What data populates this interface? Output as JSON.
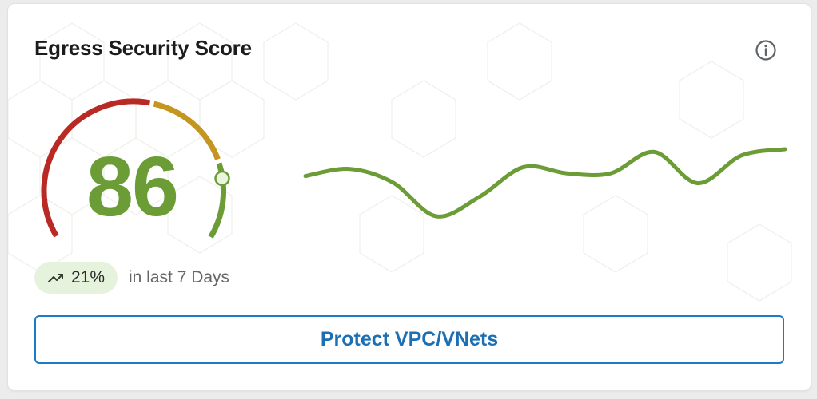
{
  "card": {
    "title": "Egress Security Score",
    "info_icon": "info-circle-icon"
  },
  "score": {
    "value": "86",
    "max": 100,
    "color": "#6b9c35"
  },
  "gauge": {
    "segments": [
      {
        "name": "poor",
        "color": "#b82a23"
      },
      {
        "name": "fair",
        "color": "#c4951f"
      },
      {
        "name": "good",
        "color": "#6b9c35"
      }
    ]
  },
  "trend": {
    "icon": "trending-up-icon",
    "value": "21%",
    "period_text": "in last 7 Days",
    "badge_color": "#e6f3dc"
  },
  "sparkline": {
    "color": "#6b9c35",
    "relative_points": [
      0.3,
      0.22,
      0.37,
      0.75,
      0.53,
      0.2,
      0.27,
      0.27,
      0.03,
      0.38,
      0.07,
      0.0
    ],
    "y_min": 0,
    "y_max": 1
  },
  "actions": {
    "protect_label": "Protect VPC/VNets",
    "accent_color": "#1d7ac7"
  }
}
